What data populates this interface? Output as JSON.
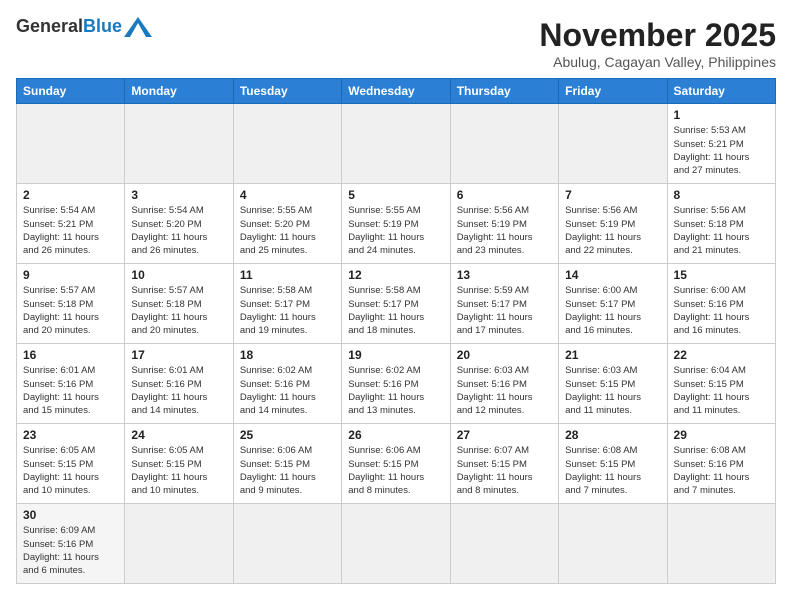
{
  "header": {
    "logo": {
      "general": "General",
      "blue": "Blue"
    },
    "title": "November 2025",
    "location": "Abulug, Cagayan Valley, Philippines"
  },
  "days_of_week": [
    "Sunday",
    "Monday",
    "Tuesday",
    "Wednesday",
    "Thursday",
    "Friday",
    "Saturday"
  ],
  "weeks": [
    [
      {
        "day": null,
        "info": ""
      },
      {
        "day": null,
        "info": ""
      },
      {
        "day": null,
        "info": ""
      },
      {
        "day": null,
        "info": ""
      },
      {
        "day": null,
        "info": ""
      },
      {
        "day": null,
        "info": ""
      },
      {
        "day": "1",
        "info": "Sunrise: 5:53 AM\nSunset: 5:21 PM\nDaylight: 11 hours\nand 27 minutes."
      }
    ],
    [
      {
        "day": "2",
        "info": "Sunrise: 5:54 AM\nSunset: 5:21 PM\nDaylight: 11 hours\nand 26 minutes."
      },
      {
        "day": "3",
        "info": "Sunrise: 5:54 AM\nSunset: 5:20 PM\nDaylight: 11 hours\nand 26 minutes."
      },
      {
        "day": "4",
        "info": "Sunrise: 5:55 AM\nSunset: 5:20 PM\nDaylight: 11 hours\nand 25 minutes."
      },
      {
        "day": "5",
        "info": "Sunrise: 5:55 AM\nSunset: 5:19 PM\nDaylight: 11 hours\nand 24 minutes."
      },
      {
        "day": "6",
        "info": "Sunrise: 5:56 AM\nSunset: 5:19 PM\nDaylight: 11 hours\nand 23 minutes."
      },
      {
        "day": "7",
        "info": "Sunrise: 5:56 AM\nSunset: 5:19 PM\nDaylight: 11 hours\nand 22 minutes."
      },
      {
        "day": "8",
        "info": "Sunrise: 5:56 AM\nSunset: 5:18 PM\nDaylight: 11 hours\nand 21 minutes."
      }
    ],
    [
      {
        "day": "9",
        "info": "Sunrise: 5:57 AM\nSunset: 5:18 PM\nDaylight: 11 hours\nand 20 minutes."
      },
      {
        "day": "10",
        "info": "Sunrise: 5:57 AM\nSunset: 5:18 PM\nDaylight: 11 hours\nand 20 minutes."
      },
      {
        "day": "11",
        "info": "Sunrise: 5:58 AM\nSunset: 5:17 PM\nDaylight: 11 hours\nand 19 minutes."
      },
      {
        "day": "12",
        "info": "Sunrise: 5:58 AM\nSunset: 5:17 PM\nDaylight: 11 hours\nand 18 minutes."
      },
      {
        "day": "13",
        "info": "Sunrise: 5:59 AM\nSunset: 5:17 PM\nDaylight: 11 hours\nand 17 minutes."
      },
      {
        "day": "14",
        "info": "Sunrise: 6:00 AM\nSunset: 5:17 PM\nDaylight: 11 hours\nand 16 minutes."
      },
      {
        "day": "15",
        "info": "Sunrise: 6:00 AM\nSunset: 5:16 PM\nDaylight: 11 hours\nand 16 minutes."
      }
    ],
    [
      {
        "day": "16",
        "info": "Sunrise: 6:01 AM\nSunset: 5:16 PM\nDaylight: 11 hours\nand 15 minutes."
      },
      {
        "day": "17",
        "info": "Sunrise: 6:01 AM\nSunset: 5:16 PM\nDaylight: 11 hours\nand 14 minutes."
      },
      {
        "day": "18",
        "info": "Sunrise: 6:02 AM\nSunset: 5:16 PM\nDaylight: 11 hours\nand 14 minutes."
      },
      {
        "day": "19",
        "info": "Sunrise: 6:02 AM\nSunset: 5:16 PM\nDaylight: 11 hours\nand 13 minutes."
      },
      {
        "day": "20",
        "info": "Sunrise: 6:03 AM\nSunset: 5:16 PM\nDaylight: 11 hours\nand 12 minutes."
      },
      {
        "day": "21",
        "info": "Sunrise: 6:03 AM\nSunset: 5:15 PM\nDaylight: 11 hours\nand 11 minutes."
      },
      {
        "day": "22",
        "info": "Sunrise: 6:04 AM\nSunset: 5:15 PM\nDaylight: 11 hours\nand 11 minutes."
      }
    ],
    [
      {
        "day": "23",
        "info": "Sunrise: 6:05 AM\nSunset: 5:15 PM\nDaylight: 11 hours\nand 10 minutes."
      },
      {
        "day": "24",
        "info": "Sunrise: 6:05 AM\nSunset: 5:15 PM\nDaylight: 11 hours\nand 10 minutes."
      },
      {
        "day": "25",
        "info": "Sunrise: 6:06 AM\nSunset: 5:15 PM\nDaylight: 11 hours\nand 9 minutes."
      },
      {
        "day": "26",
        "info": "Sunrise: 6:06 AM\nSunset: 5:15 PM\nDaylight: 11 hours\nand 8 minutes."
      },
      {
        "day": "27",
        "info": "Sunrise: 6:07 AM\nSunset: 5:15 PM\nDaylight: 11 hours\nand 8 minutes."
      },
      {
        "day": "28",
        "info": "Sunrise: 6:08 AM\nSunset: 5:15 PM\nDaylight: 11 hours\nand 7 minutes."
      },
      {
        "day": "29",
        "info": "Sunrise: 6:08 AM\nSunset: 5:16 PM\nDaylight: 11 hours\nand 7 minutes."
      }
    ],
    [
      {
        "day": "30",
        "info": "Sunrise: 6:09 AM\nSunset: 5:16 PM\nDaylight: 11 hours\nand 6 minutes."
      },
      {
        "day": null,
        "info": ""
      },
      {
        "day": null,
        "info": ""
      },
      {
        "day": null,
        "info": ""
      },
      {
        "day": null,
        "info": ""
      },
      {
        "day": null,
        "info": ""
      },
      {
        "day": null,
        "info": ""
      }
    ]
  ]
}
